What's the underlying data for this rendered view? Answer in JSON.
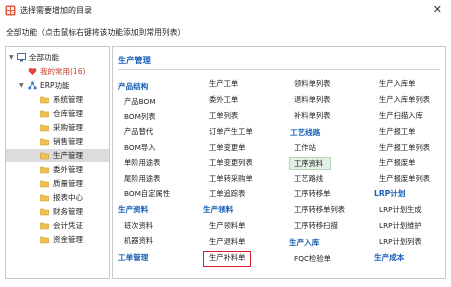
{
  "window": {
    "title": "选择需要增加的目录",
    "close_glyph": "✕"
  },
  "subtitle": "全部功能（点击鼠标右键将该功能添加到常用列表）",
  "sidebar": {
    "items": [
      {
        "label": "全部功能",
        "icon": "monitor-icon"
      },
      {
        "label": "我的常用(16)",
        "icon": "heart-icon"
      },
      {
        "label": "ERP功能",
        "icon": "network-icon"
      },
      {
        "label": "系统管理",
        "icon": "folder-icon"
      },
      {
        "label": "仓库管理",
        "icon": "folder-icon"
      },
      {
        "label": "采购管理",
        "icon": "folder-icon"
      },
      {
        "label": "销售管理",
        "icon": "folder-icon"
      },
      {
        "label": "生产管理",
        "icon": "folder-icon"
      },
      {
        "label": "委外管理",
        "icon": "folder-icon"
      },
      {
        "label": "质量管理",
        "icon": "folder-icon"
      },
      {
        "label": "报表中心",
        "icon": "folder-icon"
      },
      {
        "label": "财务管理",
        "icon": "folder-icon"
      },
      {
        "label": "会计凭证",
        "icon": "folder-icon"
      },
      {
        "label": "资金管理",
        "icon": "folder-icon"
      }
    ],
    "selected": "生产管理"
  },
  "main": {
    "title": "生产管理",
    "col1": {
      "g1": "产品结构",
      "i1": "产品BOM",
      "i2": "BOM列表",
      "i3": "产品替代",
      "i4": "BOM导入",
      "i5": "单阶用途表",
      "i6": "尾阶用途表",
      "i7": "BOM自定属性",
      "g2": "生产资料",
      "i8": "班次资料",
      "i9": "机器资料",
      "g3": "工单管理"
    },
    "col2": {
      "i1": "生产工单",
      "i2": "委外工单",
      "i3": "工单列表",
      "i4": "订单产生工单",
      "i5": "工单变更单",
      "i6": "工单变更列表",
      "i7": "工单转采购单",
      "i8": "工单追踪表",
      "g1": "生产领料",
      "i9": "生产领料单",
      "i10": "生产退料单",
      "i11": "生产补料单"
    },
    "col3": {
      "i1": "领料单列表",
      "i2": "退料单列表",
      "i3": "补料单列表",
      "g1": "工艺线路",
      "i4": "工作站",
      "i5": "工序资料",
      "i6": "工艺路线",
      "i7": "工序转移单",
      "i8": "工序转移单列表",
      "i9": "工序转移扫描",
      "g2": "生产入库",
      "i10": "FQC检验单"
    },
    "col4": {
      "i1": "生产入库单",
      "i2": "生产入库单列表",
      "i3": "生产扫描入库",
      "i4": "生产报工单",
      "i5": "生产报工单列表",
      "i6": "生产报废单",
      "i7": "生产报废单列表",
      "g1": "LRP计划",
      "i8": "LRP计划生成",
      "i9": "LRP计划维护",
      "i10": "LRP计划列表",
      "g2": "生产成本"
    },
    "highlighted_item": "工序资料",
    "boxed_item": "生产补料单"
  },
  "colors": {
    "link_blue": "#1a5fb4",
    "highlight_red": "#d8202a",
    "selected_gray": "#dcdcdc",
    "hover_green": "#e3f0e6"
  }
}
